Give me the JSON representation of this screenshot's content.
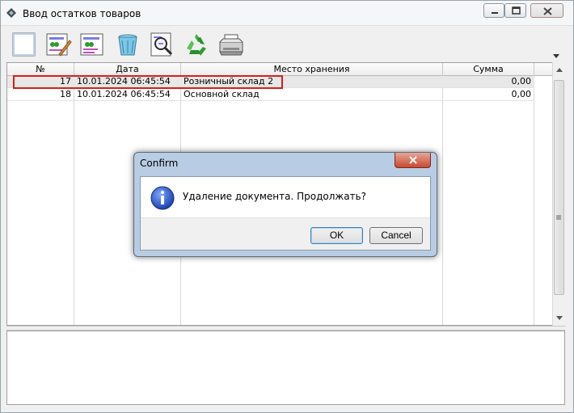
{
  "window": {
    "title": "Ввод остатков товаров"
  },
  "toolbar": {
    "buttons": [
      {
        "icon": "new-document-icon"
      },
      {
        "icon": "edit-document-icon"
      },
      {
        "icon": "copy-document-icon"
      },
      {
        "icon": "trash-bin-icon"
      },
      {
        "icon": "magnifier-search-icon"
      },
      {
        "icon": "refresh-recycle-icon"
      },
      {
        "icon": "printer-icon"
      }
    ]
  },
  "grid": {
    "columns": [
      "№",
      "Дата",
      "Место хранения",
      "Сумма"
    ],
    "rows": [
      {
        "num": "17",
        "date": "10.01.2024 06:45:54",
        "place": "Розничный склад 2",
        "sum": "0,00",
        "selected": true
      },
      {
        "num": "18",
        "date": "10.01.2024 06:45:54",
        "place": "Основной склад",
        "sum": "0,00",
        "selected": false
      }
    ]
  },
  "dialog": {
    "title": "Confirm",
    "message": "Удаление документа. Продолжать?",
    "ok_label": "OK",
    "cancel_label": "Cancel"
  },
  "colors": {
    "highlight_box": "#e01b1b",
    "dialog_frame": "#b8cde3"
  }
}
